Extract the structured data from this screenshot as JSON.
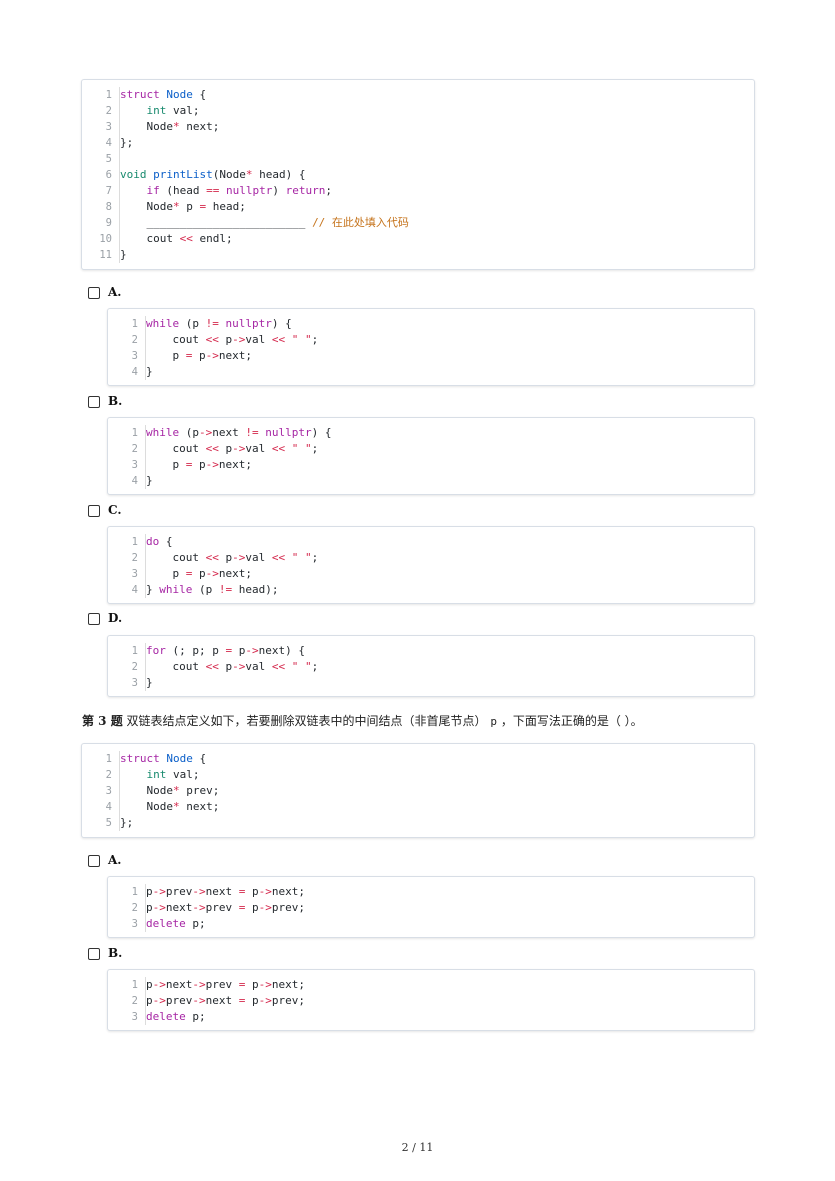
{
  "colors": {
    "keyword": "#a626a4",
    "function": "#0b5fc9",
    "type": "#188a6e",
    "operator": "#d4284c",
    "comment": "#c5731b",
    "line_number": "#9aa0a6"
  },
  "q2_code": [
    {
      "n": "1",
      "parts": [
        {
          "t": "struct",
          "c": "kw"
        },
        {
          "t": " "
        },
        {
          "t": "Node",
          "c": "fn"
        },
        {
          "t": " {"
        }
      ]
    },
    {
      "n": "2",
      "parts": [
        {
          "t": "    "
        },
        {
          "t": "int",
          "c": "ty"
        },
        {
          "t": " val;"
        }
      ]
    },
    {
      "n": "3",
      "parts": [
        {
          "t": "    Node"
        },
        {
          "t": "*",
          "c": "op"
        },
        {
          "t": " next;"
        }
      ]
    },
    {
      "n": "4",
      "parts": [
        {
          "t": "};"
        }
      ]
    },
    {
      "n": "5",
      "parts": [
        {
          "t": ""
        }
      ]
    },
    {
      "n": "6",
      "parts": [
        {
          "t": "void",
          "c": "ty"
        },
        {
          "t": " "
        },
        {
          "t": "printList",
          "c": "fn"
        },
        {
          "t": "(Node"
        },
        {
          "t": "*",
          "c": "op"
        },
        {
          "t": " head) {"
        }
      ]
    },
    {
      "n": "7",
      "parts": [
        {
          "t": "    "
        },
        {
          "t": "if",
          "c": "kw"
        },
        {
          "t": " (head "
        },
        {
          "t": "==",
          "c": "op"
        },
        {
          "t": " "
        },
        {
          "t": "nullptr",
          "c": "kw"
        },
        {
          "t": ") "
        },
        {
          "t": "return",
          "c": "kw"
        },
        {
          "t": ";"
        }
      ]
    },
    {
      "n": "8",
      "parts": [
        {
          "t": "    Node"
        },
        {
          "t": "*",
          "c": "op"
        },
        {
          "t": " p "
        },
        {
          "t": "=",
          "c": "op"
        },
        {
          "t": " head;"
        }
      ]
    },
    {
      "n": "9",
      "parts": [
        {
          "t": "    ________________________ "
        },
        {
          "t": "// 在此处填入代码",
          "c": "cm"
        }
      ]
    },
    {
      "n": "10",
      "parts": [
        {
          "t": "    cout "
        },
        {
          "t": "<<",
          "c": "op"
        },
        {
          "t": " endl;"
        }
      ]
    },
    {
      "n": "11",
      "parts": [
        {
          "t": "}"
        }
      ]
    }
  ],
  "q2_options": [
    {
      "label": "A.",
      "code": [
        {
          "n": "1",
          "parts": [
            {
              "t": "while",
              "c": "kw"
            },
            {
              "t": " (p "
            },
            {
              "t": "!=",
              "c": "op"
            },
            {
              "t": " "
            },
            {
              "t": "nullptr",
              "c": "kw"
            },
            {
              "t": ") {"
            }
          ]
        },
        {
          "n": "2",
          "parts": [
            {
              "t": "    cout "
            },
            {
              "t": "<<",
              "c": "op"
            },
            {
              "t": " p"
            },
            {
              "t": "->",
              "c": "op"
            },
            {
              "t": "val "
            },
            {
              "t": "<<",
              "c": "op"
            },
            {
              "t": " "
            },
            {
              "t": "\" \"",
              "c": "str"
            },
            {
              "t": ";"
            }
          ]
        },
        {
          "n": "3",
          "parts": [
            {
              "t": "    p "
            },
            {
              "t": "=",
              "c": "op"
            },
            {
              "t": " p"
            },
            {
              "t": "->",
              "c": "op"
            },
            {
              "t": "next;"
            }
          ]
        },
        {
          "n": "4",
          "parts": [
            {
              "t": "}"
            }
          ]
        }
      ]
    },
    {
      "label": "B.",
      "code": [
        {
          "n": "1",
          "parts": [
            {
              "t": "while",
              "c": "kw"
            },
            {
              "t": " (p"
            },
            {
              "t": "->",
              "c": "op"
            },
            {
              "t": "next "
            },
            {
              "t": "!=",
              "c": "op"
            },
            {
              "t": " "
            },
            {
              "t": "nullptr",
              "c": "kw"
            },
            {
              "t": ") {"
            }
          ]
        },
        {
          "n": "2",
          "parts": [
            {
              "t": "    cout "
            },
            {
              "t": "<<",
              "c": "op"
            },
            {
              "t": " p"
            },
            {
              "t": "->",
              "c": "op"
            },
            {
              "t": "val "
            },
            {
              "t": "<<",
              "c": "op"
            },
            {
              "t": " "
            },
            {
              "t": "\" \"",
              "c": "str"
            },
            {
              "t": ";"
            }
          ]
        },
        {
          "n": "3",
          "parts": [
            {
              "t": "    p "
            },
            {
              "t": "=",
              "c": "op"
            },
            {
              "t": " p"
            },
            {
              "t": "->",
              "c": "op"
            },
            {
              "t": "next;"
            }
          ]
        },
        {
          "n": "4",
          "parts": [
            {
              "t": "}"
            }
          ]
        }
      ]
    },
    {
      "label": "C.",
      "code": [
        {
          "n": "1",
          "parts": [
            {
              "t": "do",
              "c": "kw"
            },
            {
              "t": " {"
            }
          ]
        },
        {
          "n": "2",
          "parts": [
            {
              "t": "    cout "
            },
            {
              "t": "<<",
              "c": "op"
            },
            {
              "t": " p"
            },
            {
              "t": "->",
              "c": "op"
            },
            {
              "t": "val "
            },
            {
              "t": "<<",
              "c": "op"
            },
            {
              "t": " "
            },
            {
              "t": "\" \"",
              "c": "str"
            },
            {
              "t": ";"
            }
          ]
        },
        {
          "n": "3",
          "parts": [
            {
              "t": "    p "
            },
            {
              "t": "=",
              "c": "op"
            },
            {
              "t": " p"
            },
            {
              "t": "->",
              "c": "op"
            },
            {
              "t": "next;"
            }
          ]
        },
        {
          "n": "4",
          "parts": [
            {
              "t": "} "
            },
            {
              "t": "while",
              "c": "kw"
            },
            {
              "t": " (p "
            },
            {
              "t": "!=",
              "c": "op"
            },
            {
              "t": " head);"
            }
          ]
        }
      ]
    },
    {
      "label": "D.",
      "code": [
        {
          "n": "1",
          "parts": [
            {
              "t": "for",
              "c": "kw"
            },
            {
              "t": " (; p; p "
            },
            {
              "t": "=",
              "c": "op"
            },
            {
              "t": " p"
            },
            {
              "t": "->",
              "c": "op"
            },
            {
              "t": "next) {"
            }
          ]
        },
        {
          "n": "2",
          "parts": [
            {
              "t": "    cout "
            },
            {
              "t": "<<",
              "c": "op"
            },
            {
              "t": " p"
            },
            {
              "t": "->",
              "c": "op"
            },
            {
              "t": "val "
            },
            {
              "t": "<<",
              "c": "op"
            },
            {
              "t": " "
            },
            {
              "t": "\" \"",
              "c": "str"
            },
            {
              "t": ";"
            }
          ]
        },
        {
          "n": "3",
          "parts": [
            {
              "t": "}"
            }
          ]
        }
      ]
    }
  ],
  "q3": {
    "number": "第 3 题",
    "text_before": "双链表结点定义如下，若要删除双链表中的中间结点（非首尾节点）",
    "var": "p",
    "text_after": "，下面写法正确的是（  ）。"
  },
  "q3_code": [
    {
      "n": "1",
      "parts": [
        {
          "t": "struct",
          "c": "kw"
        },
        {
          "t": " "
        },
        {
          "t": "Node",
          "c": "fn"
        },
        {
          "t": " {"
        }
      ]
    },
    {
      "n": "2",
      "parts": [
        {
          "t": "    "
        },
        {
          "t": "int",
          "c": "ty"
        },
        {
          "t": " val;"
        }
      ]
    },
    {
      "n": "3",
      "parts": [
        {
          "t": "    Node"
        },
        {
          "t": "*",
          "c": "op"
        },
        {
          "t": " prev;"
        }
      ]
    },
    {
      "n": "4",
      "parts": [
        {
          "t": "    Node"
        },
        {
          "t": "*",
          "c": "op"
        },
        {
          "t": " next;"
        }
      ]
    },
    {
      "n": "5",
      "parts": [
        {
          "t": "};"
        }
      ]
    }
  ],
  "q3_options": [
    {
      "label": "A.",
      "code": [
        {
          "n": "1",
          "parts": [
            {
              "t": "p"
            },
            {
              "t": "->",
              "c": "op"
            },
            {
              "t": "prev"
            },
            {
              "t": "->",
              "c": "op"
            },
            {
              "t": "next "
            },
            {
              "t": "=",
              "c": "op"
            },
            {
              "t": " p"
            },
            {
              "t": "->",
              "c": "op"
            },
            {
              "t": "next;"
            }
          ]
        },
        {
          "n": "2",
          "parts": [
            {
              "t": "p"
            },
            {
              "t": "->",
              "c": "op"
            },
            {
              "t": "next"
            },
            {
              "t": "->",
              "c": "op"
            },
            {
              "t": "prev "
            },
            {
              "t": "=",
              "c": "op"
            },
            {
              "t": " p"
            },
            {
              "t": "->",
              "c": "op"
            },
            {
              "t": "prev;"
            }
          ]
        },
        {
          "n": "3",
          "parts": [
            {
              "t": "delete",
              "c": "kw"
            },
            {
              "t": " p;"
            }
          ]
        }
      ]
    },
    {
      "label": "B.",
      "code": [
        {
          "n": "1",
          "parts": [
            {
              "t": "p"
            },
            {
              "t": "->",
              "c": "op"
            },
            {
              "t": "next"
            },
            {
              "t": "->",
              "c": "op"
            },
            {
              "t": "prev "
            },
            {
              "t": "=",
              "c": "op"
            },
            {
              "t": " p"
            },
            {
              "t": "->",
              "c": "op"
            },
            {
              "t": "next;"
            }
          ]
        },
        {
          "n": "2",
          "parts": [
            {
              "t": "p"
            },
            {
              "t": "->",
              "c": "op"
            },
            {
              "t": "prev"
            },
            {
              "t": "->",
              "c": "op"
            },
            {
              "t": "next "
            },
            {
              "t": "=",
              "c": "op"
            },
            {
              "t": " p"
            },
            {
              "t": "->",
              "c": "op"
            },
            {
              "t": "prev;"
            }
          ]
        },
        {
          "n": "3",
          "parts": [
            {
              "t": "delete",
              "c": "kw"
            },
            {
              "t": " p;"
            }
          ]
        }
      ]
    }
  ],
  "footer": {
    "page": "2 / 11"
  }
}
